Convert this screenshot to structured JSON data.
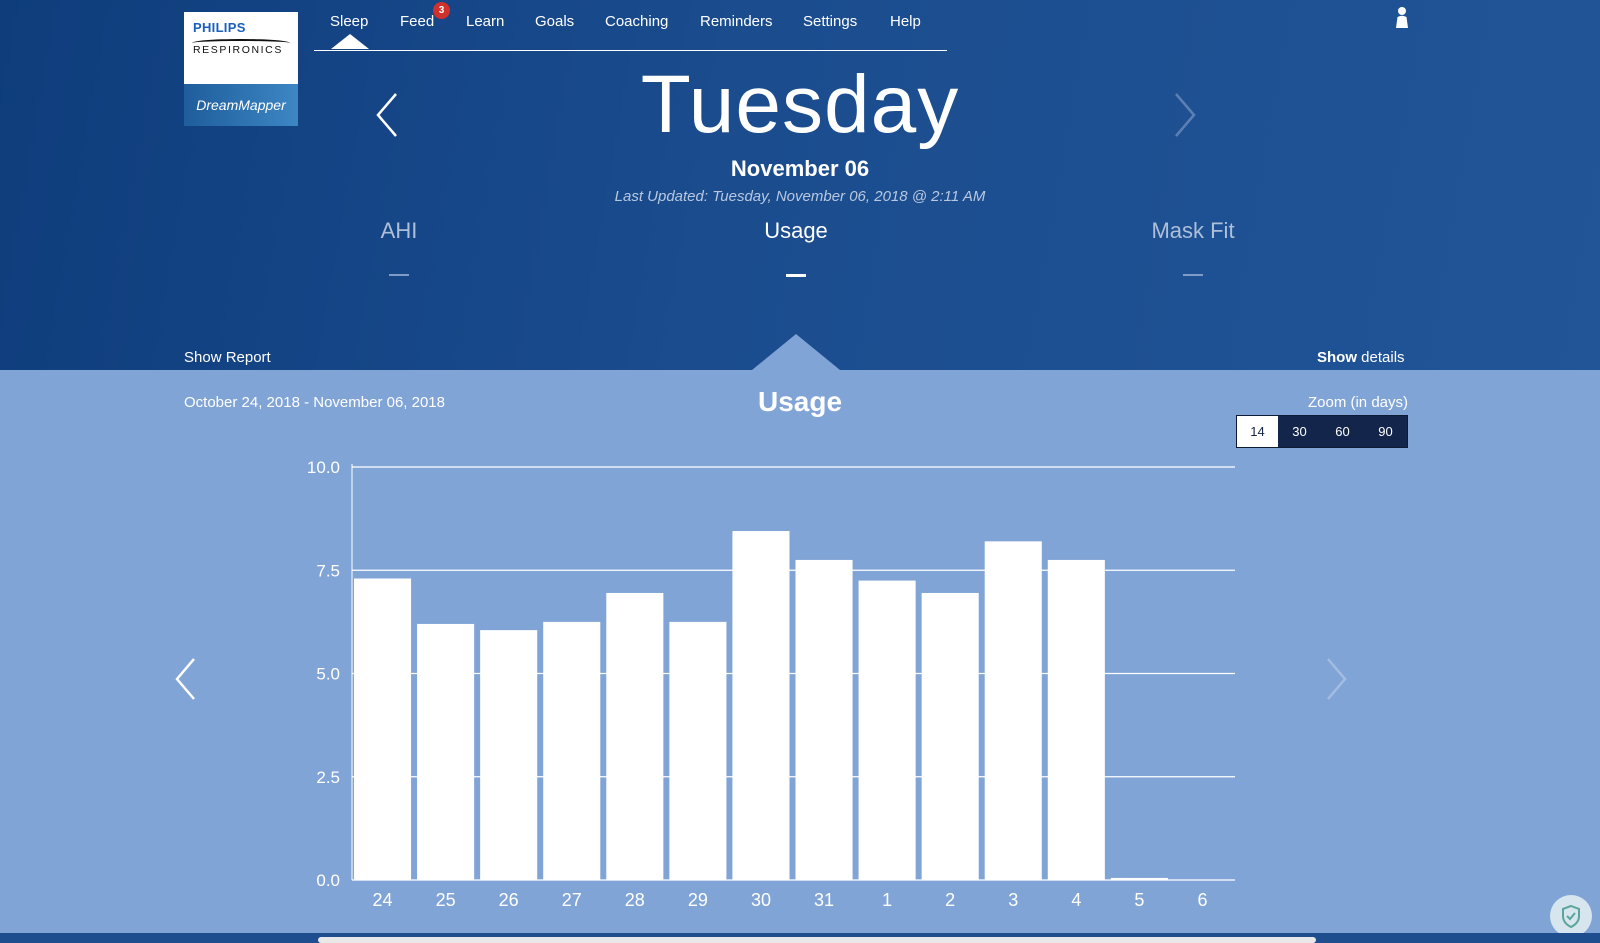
{
  "logo": {
    "brand": "PHILIPS",
    "subbrand": "RESPIRONICS",
    "product": "DreamMapper"
  },
  "nav": {
    "items": [
      {
        "label": "Sleep",
        "active": true
      },
      {
        "label": "Feed",
        "badge": "3"
      },
      {
        "label": "Learn"
      },
      {
        "label": "Goals"
      },
      {
        "label": "Coaching"
      },
      {
        "label": "Reminders"
      },
      {
        "label": "Settings"
      },
      {
        "label": "Help"
      }
    ]
  },
  "header": {
    "day": "Tuesday",
    "date": "November 06",
    "last_updated": "Last Updated: Tuesday, November 06, 2018 @ 2:11 AM"
  },
  "metrics": {
    "tabs": [
      {
        "label": "AHI"
      },
      {
        "label": "Usage",
        "active": true
      },
      {
        "label": "Mask Fit"
      }
    ]
  },
  "links": {
    "show_report": "Show Report",
    "show_bold": "Show",
    "details": "details"
  },
  "panel": {
    "date_range": "October 24, 2018 - November 06, 2018",
    "title": "Usage",
    "zoom_label": "Zoom (in days)",
    "zoom_options": [
      "14",
      "30",
      "60",
      "90"
    ],
    "zoom_selected": "14"
  },
  "colors": {
    "header_bg": "#1a4c8e",
    "panel_bg": "#81a4d6",
    "bar": "#ffffff",
    "zoom_bg": "#13254a",
    "badge": "#d0312d"
  },
  "icons": {
    "user": "user-icon",
    "day_prev": "chevron-left-icon",
    "day_next": "chevron-right-icon",
    "chart_prev": "chevron-left-icon",
    "chart_next": "chevron-right-icon",
    "shield": "shield-check-icon"
  },
  "chart_data": {
    "type": "bar",
    "title": "Usage",
    "categories": [
      "24",
      "25",
      "26",
      "27",
      "28",
      "29",
      "30",
      "31",
      "1",
      "2",
      "3",
      "4",
      "5",
      "6"
    ],
    "values": [
      7.3,
      6.2,
      6.05,
      6.25,
      6.95,
      6.25,
      8.45,
      7.75,
      7.25,
      6.95,
      8.2,
      7.75,
      0.05,
      0
    ],
    "ylim": [
      0,
      10
    ],
    "yticks": [
      "0.0",
      "2.5",
      "5.0",
      "7.5",
      "10.0"
    ],
    "grid": true
  }
}
